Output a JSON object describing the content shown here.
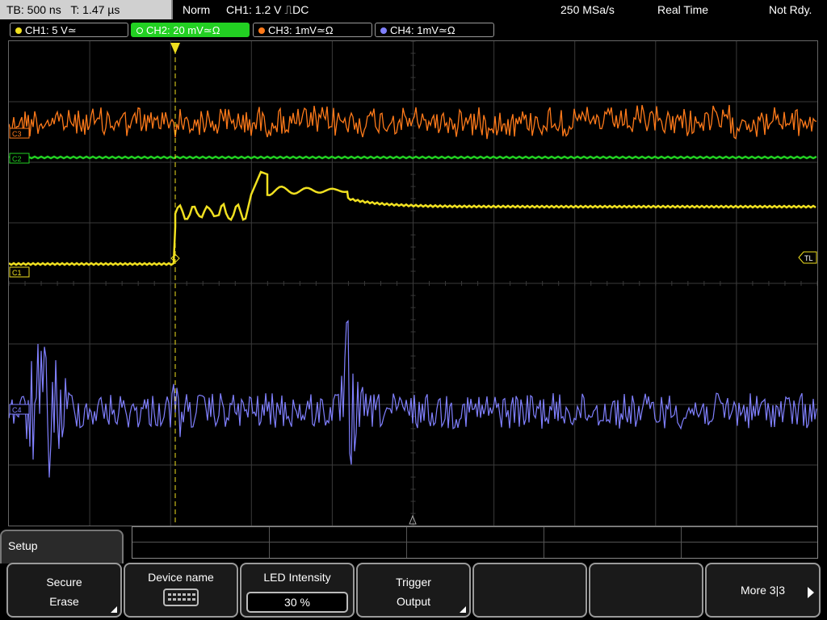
{
  "status": {
    "timebase": "TB: 500 ns",
    "trigger_time": "T: 1.47 µs",
    "mode": "Norm",
    "trigger_info": "CH1: 1.2 V ⎍DC",
    "sample_rate": "250 MSa/s",
    "acq_mode": "Real Time",
    "ready_state": "Not Rdy."
  },
  "channels": [
    {
      "label": "CH1: 5 V≃",
      "color": "#f0e020",
      "active": false
    },
    {
      "label": "CH2: 20 mV≃Ω",
      "color": "#22d022",
      "active": true
    },
    {
      "label": "CH3: 1mV≃Ω",
      "color": "#ff7a1a",
      "active": false
    },
    {
      "label": "CH4: 1mV≃Ω",
      "color": "#8080ff",
      "active": false
    }
  ],
  "markers": {
    "ch3": "C3",
    "ch2": "C2",
    "ch1": "C1",
    "ch4": "C4",
    "trigger_level": "TL"
  },
  "colors": {
    "ch1": "#f0e020",
    "ch2": "#22d022",
    "ch3": "#ff7a1a",
    "ch4": "#8080ff",
    "grid": "#3a3a3a"
  },
  "menu": {
    "title": "Setup",
    "softkeys": [
      {
        "line1": "Secure",
        "line2": "Erase"
      },
      {
        "line1": "Device name",
        "icon": "keyboard-icon"
      },
      {
        "line1": "LED Intensity",
        "value": "30 %"
      },
      {
        "line1": "Trigger",
        "line2": "Output"
      },
      {
        "line1": ""
      },
      {
        "line1": ""
      },
      {
        "line1": "More 3|3"
      }
    ]
  }
}
